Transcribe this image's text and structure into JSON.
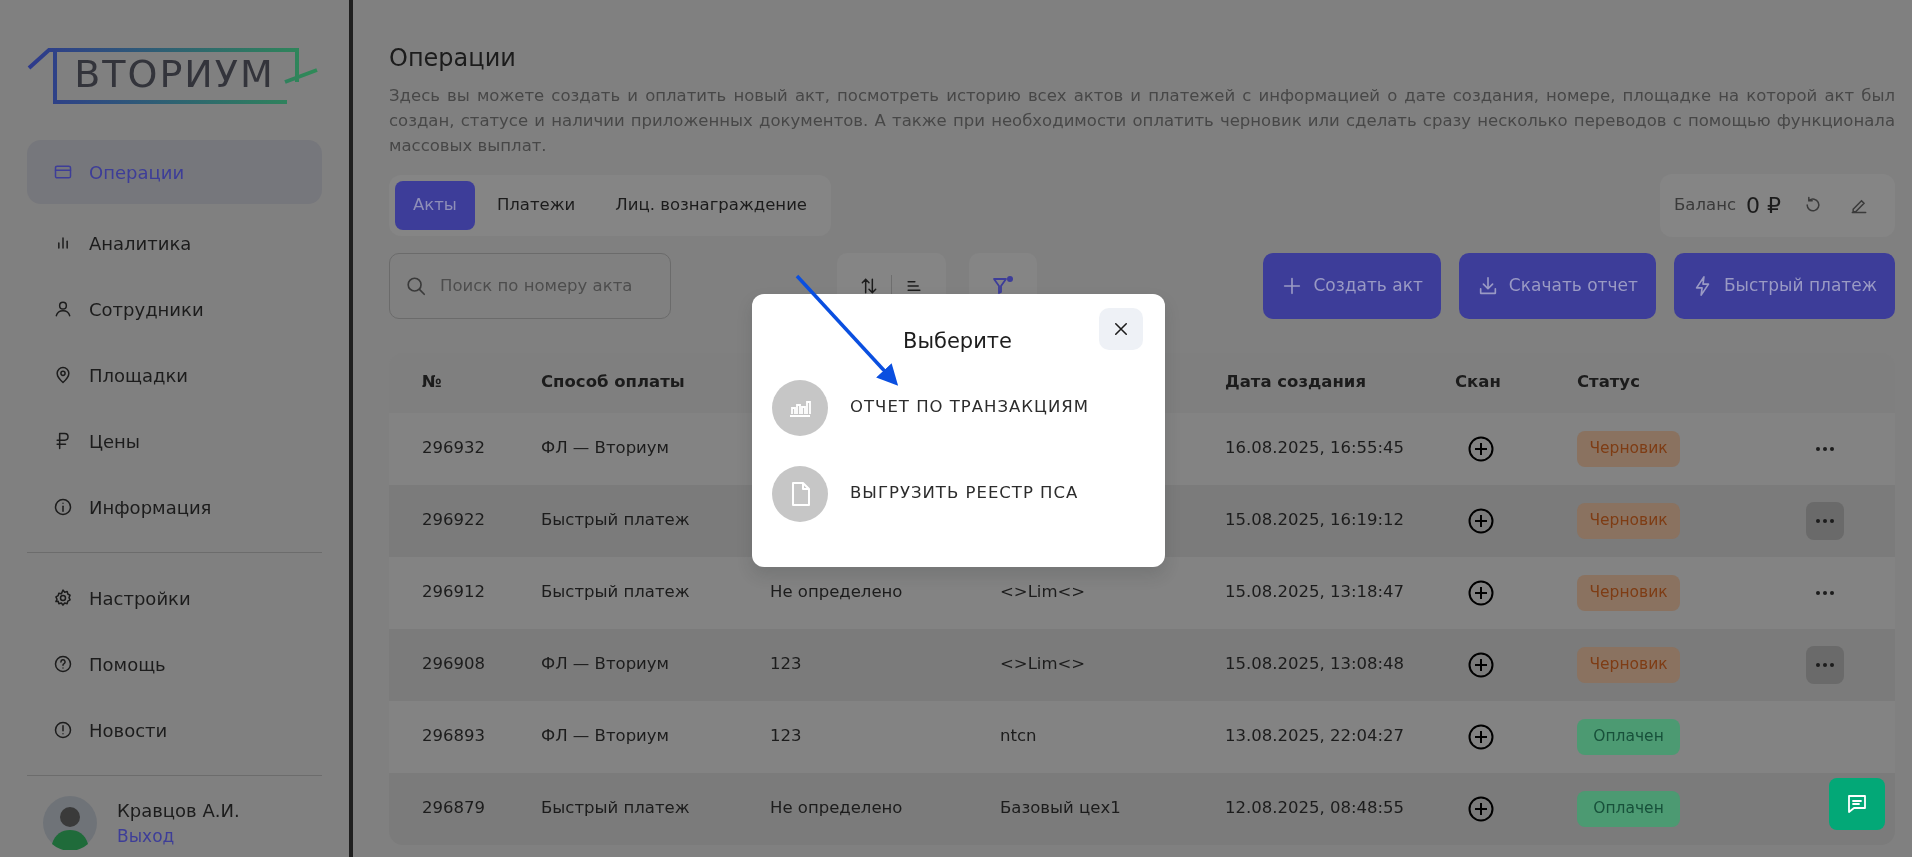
{
  "sidebar": {
    "logo": "ВТОРИУМ",
    "items": [
      {
        "label": "Операции",
        "selected": true
      },
      {
        "label": "Аналитика",
        "selected": false
      },
      {
        "label": "Сотрудники",
        "selected": false
      },
      {
        "label": "Площадки",
        "selected": false
      },
      {
        "label": "Цены",
        "selected": false
      },
      {
        "label": "Информация",
        "selected": false
      }
    ],
    "bottom_items": [
      {
        "label": "Настройки",
        "selected": false
      },
      {
        "label": "Помощь",
        "selected": false
      },
      {
        "label": "Новости",
        "selected": false
      }
    ],
    "user": {
      "name": "Кравцов А.И.",
      "logout": "Выход"
    }
  },
  "page": {
    "title": "Операции",
    "description": "Здесь вы можете создать и оплатить новый акт, посмотреть историю всех актов и платежей с информацией о дате создания, номере, площадке на которой акт был создан, статусе и наличии приложенных документов. А также при необходимости оплатить черновик или сделать сразу несколько переводов с помощью функционала массовых выплат."
  },
  "tabs": [
    {
      "label": "Акты",
      "selected": true
    },
    {
      "label": "Платежи",
      "selected": false
    },
    {
      "label": "Лиц. вознаграждение",
      "selected": false
    }
  ],
  "balance": {
    "label": "Баланс",
    "value": "0 ₽"
  },
  "search": {
    "placeholder": "Поиск по номеру акта"
  },
  "actions": [
    {
      "label": "Создать акт"
    },
    {
      "label": "Скачать отчет"
    },
    {
      "label": "Быстрый платеж"
    }
  ],
  "table": {
    "columns": [
      {
        "label": "№"
      },
      {
        "label": "Способ оплаты"
      },
      {},
      {},
      {
        "label": "Дата создания"
      },
      {
        "label": "Скан"
      },
      {
        "label": "Статус"
      },
      {}
    ],
    "rows": [
      {
        "number": "296932",
        "payment_method": "ФЛ — Вториум",
        "date": "16.08.2025, 16:55:45",
        "status": {
          "label": "Черновик",
          "kind": "draft"
        },
        "menu_highlighted": false
      },
      {
        "number": "296922",
        "payment_method": "Быстрый платеж",
        "date": "15.08.2025, 16:19:12",
        "status": {
          "label": "Черновик",
          "kind": "draft"
        },
        "menu_highlighted": true
      },
      {
        "number": "296912",
        "payment_method": "Быстрый платеж",
        "column_3": "Не определено",
        "column_4": "<>Lim<>",
        "date": "15.08.2025, 13:18:47",
        "status": {
          "label": "Черновик",
          "kind": "draft"
        },
        "menu_highlighted": false
      },
      {
        "number": "296908",
        "payment_method": "ФЛ — Вториум",
        "column_3": "123",
        "column_4": "<>Lim<>",
        "date": "15.08.2025, 13:08:48",
        "status": {
          "label": "Черновик",
          "kind": "draft"
        },
        "menu_highlighted": true
      },
      {
        "number": "296893",
        "payment_method": "ФЛ — Вториум",
        "column_3": "123",
        "column_4": "ntcn",
        "date": "13.08.2025, 22:04:27",
        "status": {
          "label": "Оплачен",
          "kind": "paid"
        }
      },
      {
        "number": "296879",
        "payment_method": "Быстрый платеж",
        "column_3": "Не определено",
        "column_4": "Базовый цех1",
        "date": "12.08.2025, 08:48:55",
        "status": {
          "label": "Оплачен",
          "kind": "paid"
        }
      }
    ]
  },
  "modal": {
    "title": "Выберите",
    "options": [
      {
        "label": "ОТЧЕТ ПО ТРАНЗАКЦИЯМ"
      },
      {
        "label": "ВЫГРУЗИТЬ РЕЕСТР ПСА"
      }
    ]
  }
}
